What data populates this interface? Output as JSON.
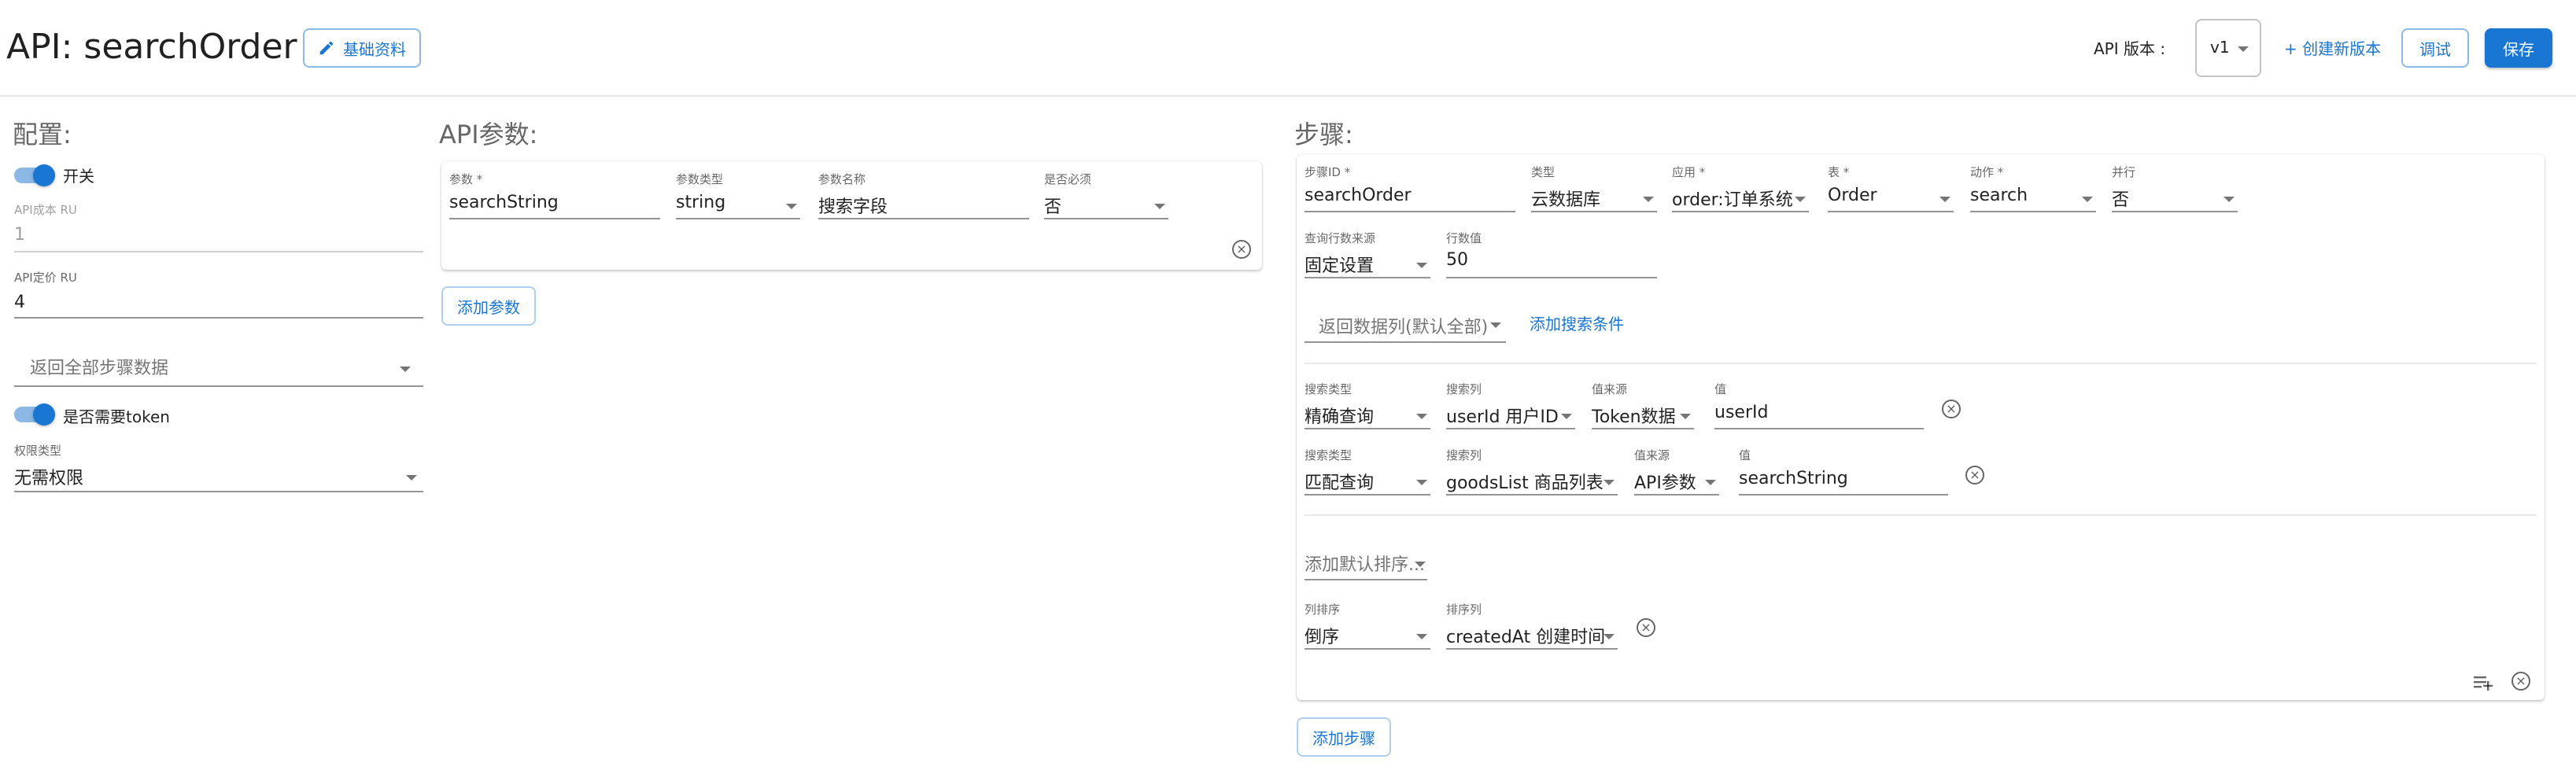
{
  "header": {
    "title": "API: searchOrder",
    "basic_info_label": "基础资料",
    "version_label": "API 版本 :",
    "version_value": "v1",
    "create_version_label": "+ 创建新版本",
    "debug_label": "调试",
    "save_label": "保存"
  },
  "config": {
    "title": "配置:",
    "enable_label": "开关",
    "cost_label": "API成本 RU",
    "cost_value": "1",
    "price_label": "API定价 RU",
    "price_value": "4",
    "return_steps_placeholder": "返回全部步骤数据",
    "token_label": "是否需要token",
    "permission_label": "权限类型",
    "permission_value": "无需权限"
  },
  "params": {
    "title": "API参数:",
    "labels": {
      "name": "参数",
      "type": "参数类型",
      "display": "参数名称",
      "required": "是否必须"
    },
    "row": {
      "name": "searchString",
      "type": "string",
      "display": "搜索字段",
      "required": "否"
    },
    "add_label": "添加参数"
  },
  "steps": {
    "title": "步骤:",
    "step": {
      "labels": {
        "id": "步骤ID",
        "type": "类型",
        "app": "应用",
        "table": "表",
        "action": "动作",
        "parallel": "并行"
      },
      "values": {
        "id": "searchOrder",
        "type": "云数据库",
        "app": "order:订单系统",
        "table": "Order",
        "action": "search",
        "parallel": "否"
      },
      "rows_source_label": "查询行数来源",
      "rows_source_value": "固定设置",
      "rows_value_label": "行数值",
      "rows_value": "50",
      "return_columns_placeholder": "返回数据列(默认全部)",
      "add_condition_label": "添加搜索条件",
      "conditions": [
        {
          "labels": {
            "search_type": "搜索类型",
            "search_column": "搜索列",
            "value_source": "值来源",
            "value": "值"
          },
          "search_type": "精确查询",
          "search_column": "userId 用户ID",
          "value_source": "Token数据",
          "value": "userId"
        },
        {
          "labels": {
            "search_type": "搜索类型",
            "search_column": "搜索列",
            "value_source": "值来源",
            "value": "值"
          },
          "search_type": "匹配查询",
          "search_column": "goodsList 商品列表",
          "value_source": "API参数",
          "value": "searchString"
        }
      ],
      "add_sort_placeholder": "添加默认排序...",
      "sort": {
        "labels": {
          "order": "列排序",
          "column": "排序列"
        },
        "order": "倒序",
        "column": "createdAt 创建时间"
      }
    },
    "add_step_label": "添加步骤"
  }
}
